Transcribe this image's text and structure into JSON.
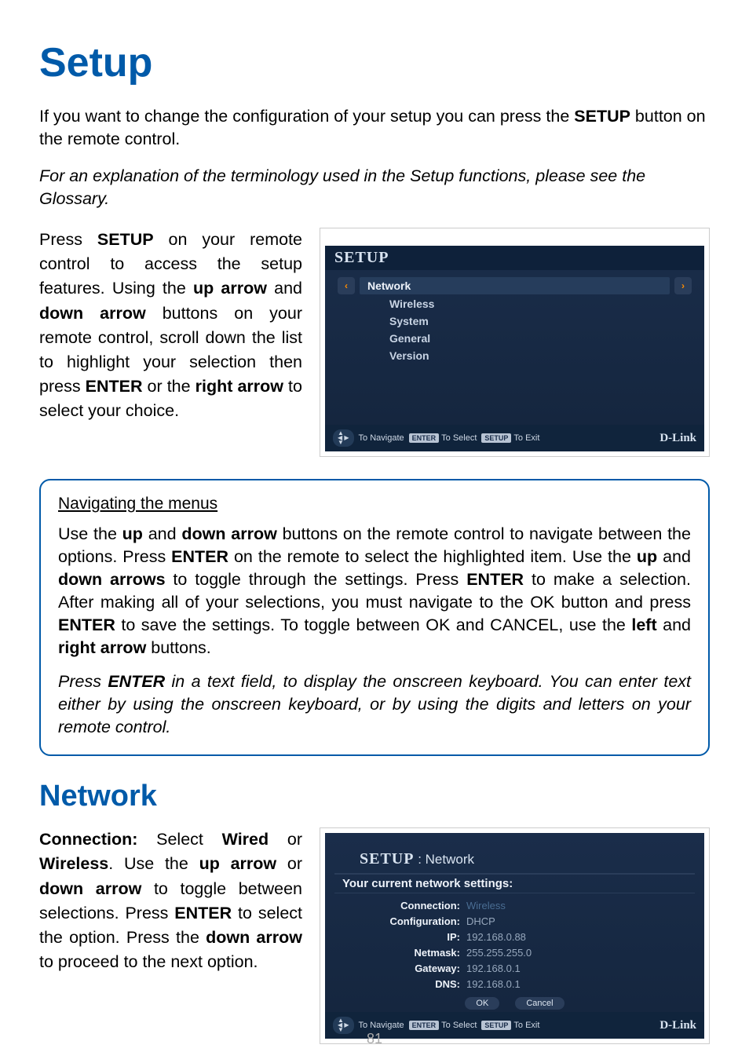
{
  "page_number": "81",
  "heading_setup": "Setup",
  "intro_pre": "If you want to change the configuration of your setup you can press the ",
  "intro_bold": "SETUP",
  "intro_post": " button on the remote control.",
  "glossary_note": "For an explanation of the terminology used in the Setup functions, please see the Glossary.",
  "instr": {
    "t1": "Press ",
    "b1": "SETUP",
    "t2": " on your remote control to access the setup features. Using the ",
    "b2": "up arrow",
    "t3": " and ",
    "b3": "down arrow",
    "t4": " buttons on your remote control, scroll down the list to highlight your selection then press ",
    "b4": "ENTER",
    "t5": " or the ",
    "b5": "right arrow",
    "t6": " to select your choice."
  },
  "setup_screen": {
    "title": "SETUP",
    "items": [
      "Network",
      "Wireless",
      "System",
      "General",
      "Version"
    ],
    "footer_nav": "To Navigate",
    "footer_enter_pill": "ENTER",
    "footer_select": "To Select",
    "footer_setup_pill": "SETUP",
    "footer_exit": "To Exit",
    "brand": "D-Link"
  },
  "nav_box": {
    "title": "Navigating the menus",
    "p1": {
      "t1": "Use the ",
      "b1": "up",
      "t2": " and ",
      "b2": "down arrow",
      "t3": " buttons on the remote control to navigate between the options. Press ",
      "b3": "ENTER",
      "t4": " on the remote to select the highlighted item. Use the ",
      "b4": "up",
      "t5": " and ",
      "b5": "down arrows",
      "t6": " to toggle through the settings. Press ",
      "b6": "ENTER",
      "t7": " to make a selection. After making all of your selections, you must navigate to the OK button and press ",
      "b7": "ENTER",
      "t8": " to save the settings. To toggle between OK and CANCEL, use the ",
      "b8": "left",
      "t9": " and ",
      "b9": "right arrow",
      "t10": " buttons."
    },
    "p2_pre": "Press ",
    "p2_bold": "ENTER",
    "p2_post": " in a text field, to display the onscreen keyboard. You can enter text either by using the onscreen keyboard, or by using the digits and letters on your remote control."
  },
  "heading_network": "Network",
  "network_text": {
    "b1": "Connection:",
    "t1": " Select ",
    "b2": "Wired",
    "t2": " or ",
    "b3": "Wireless",
    "t3": ". Use the ",
    "b4": "up arrow",
    "t4": " or ",
    "b5": "down arrow",
    "t5": " to toggle between selections. Press ",
    "b6": "ENTER",
    "t6": " to select the option. Press the ",
    "b7": "down arrow",
    "t7": " to proceed to the next option."
  },
  "net_screen": {
    "title_main": "SETUP",
    "title_sep": " : ",
    "title_sub": "Network",
    "subtitle": "Your current network settings:",
    "rows": [
      {
        "k": "Connection:",
        "v": "Wireless",
        "sel": true
      },
      {
        "k": "Configuration:",
        "v": "DHCP"
      },
      {
        "k": "IP:",
        "v": "192.168.0.88"
      },
      {
        "k": "Netmask:",
        "v": "255.255.255.0"
      },
      {
        "k": "Gateway:",
        "v": "192.168.0.1"
      },
      {
        "k": "DNS:",
        "v": "192.168.0.1"
      }
    ],
    "ok": "OK",
    "cancel": "Cancel"
  }
}
